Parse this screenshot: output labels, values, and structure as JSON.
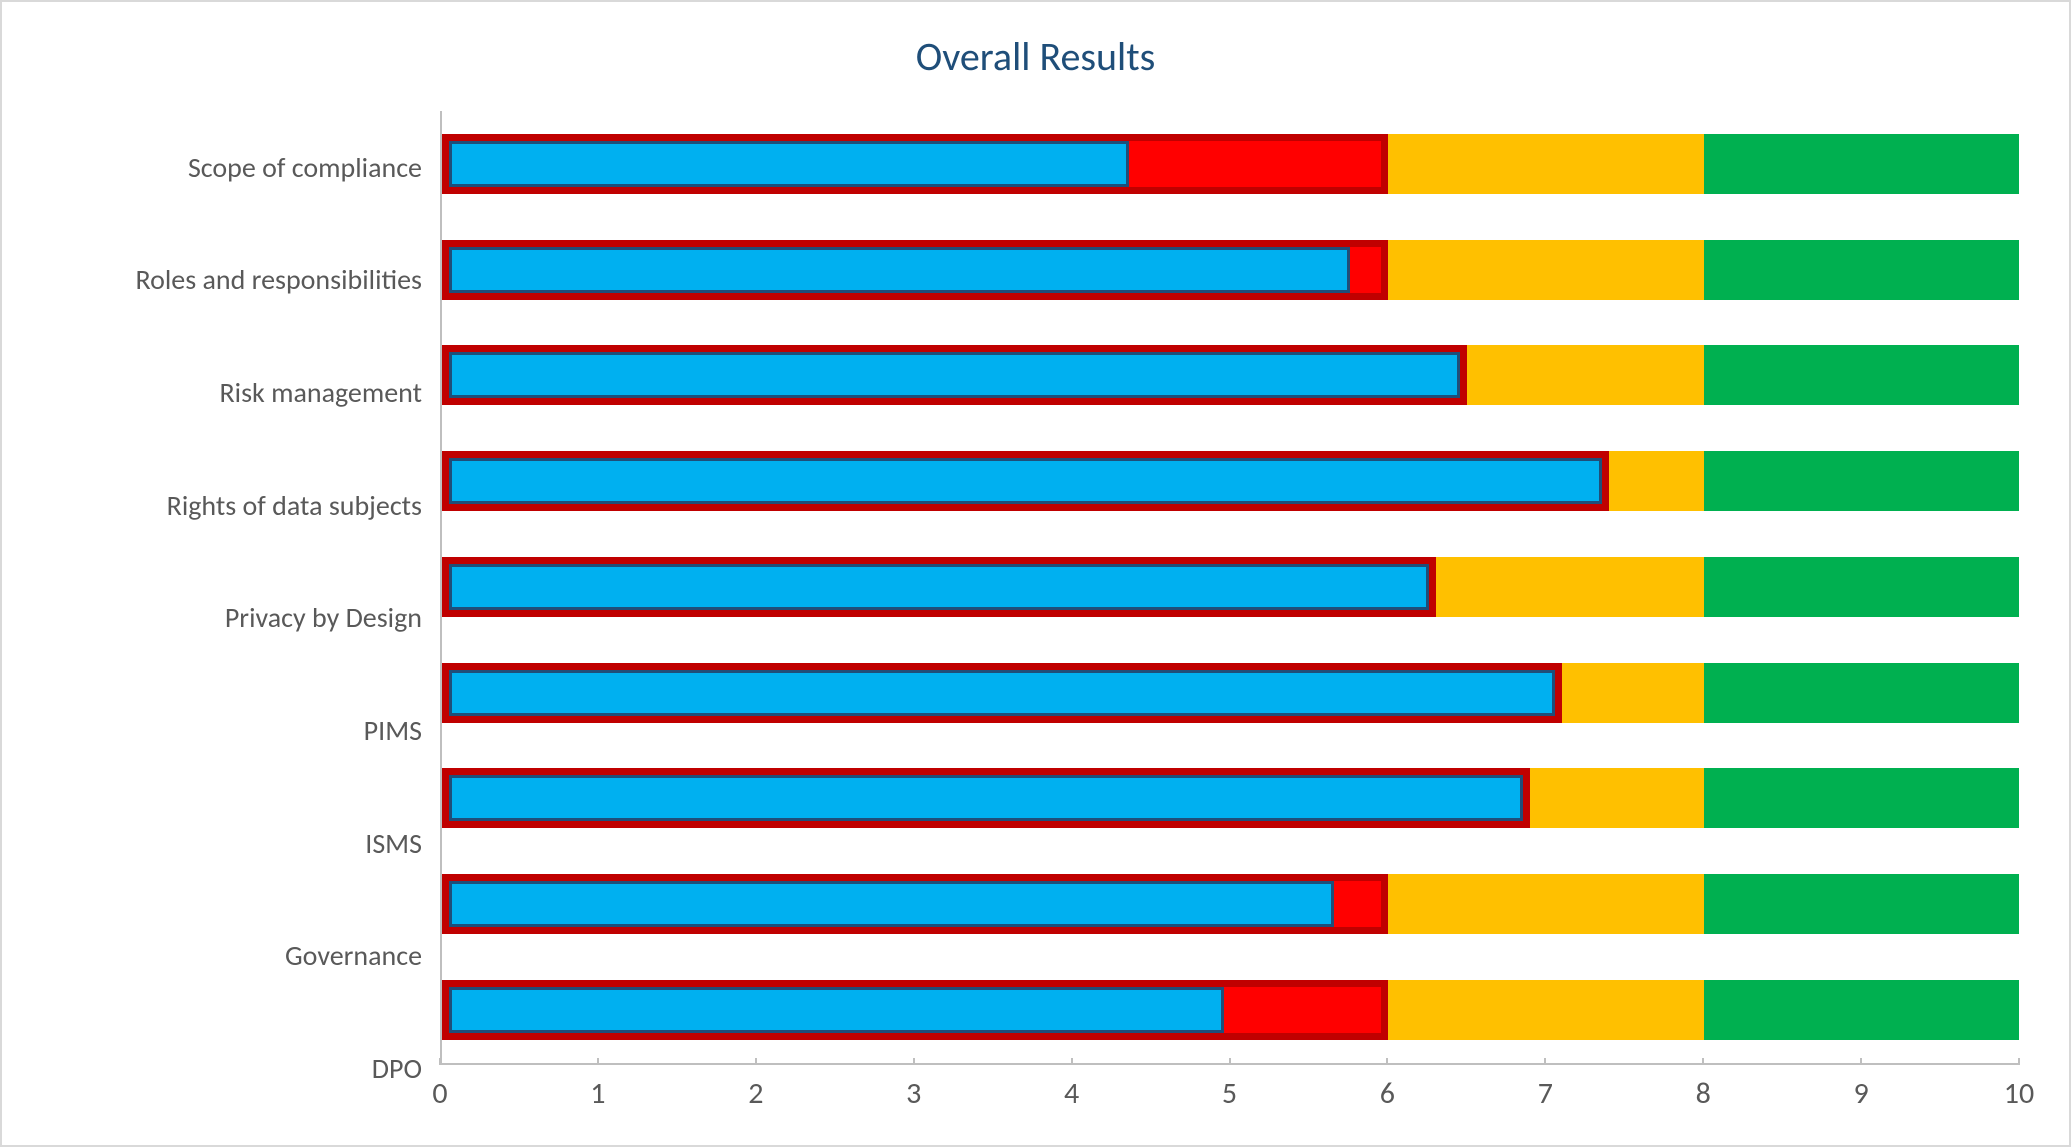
{
  "chart_data": {
    "type": "bar",
    "orientation": "horizontal",
    "title": "Overall Results",
    "xlabel": "",
    "ylabel": "",
    "xlim": [
      0,
      10
    ],
    "x_ticks": [
      0,
      1,
      2,
      3,
      4,
      5,
      6,
      7,
      8,
      9,
      10
    ],
    "zones": [
      {
        "name": "red",
        "from": 0,
        "to": 6,
        "color": "#ff0000"
      },
      {
        "name": "amber",
        "from": 6,
        "to": 8,
        "color": "#ffc000"
      },
      {
        "name": "green",
        "from": 8,
        "to": 10,
        "color": "#00b050"
      }
    ],
    "categories": [
      "Scope of compliance",
      "Roles and responsibilities",
      "Risk management",
      "Rights of data subjects",
      "Privacy by Design",
      "PIMS",
      "ISMS",
      "Governance",
      "DPO"
    ],
    "values": [
      4.4,
      5.8,
      6.5,
      7.4,
      6.3,
      7.1,
      6.9,
      5.7,
      5.0
    ],
    "bar_fill_color": "#00b0f0",
    "bar_edge_color": "#1f4e79",
    "bar_frame_color": "#c00000"
  },
  "colors": {
    "title": "#1f4e79",
    "axis": "#bfbfbf",
    "tick_text": "#595959"
  }
}
